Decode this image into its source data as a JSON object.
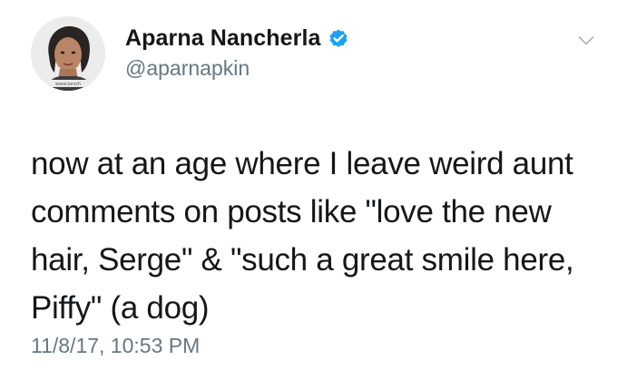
{
  "author": {
    "display_name": "Aparna Nancherla",
    "handle": "@aparnapkin",
    "verified": true,
    "avatar_caption": "www.kevsh"
  },
  "tweet": {
    "text_lines": [
      "now at an age where I leave weird aunt",
      "comments on posts like \"love the new",
      "hair, Serge\" & \"such a great smile here,",
      "Piffy\" (a dog)"
    ],
    "timestamp": "11/8/17, 10:53 PM"
  },
  "icons": {
    "verified": "verified-badge-icon",
    "menu": "chevron-down-icon"
  },
  "colors": {
    "text": "#14171a",
    "secondary": "#657786",
    "verified_blue": "#1da1f2",
    "background": "#ffffff"
  }
}
